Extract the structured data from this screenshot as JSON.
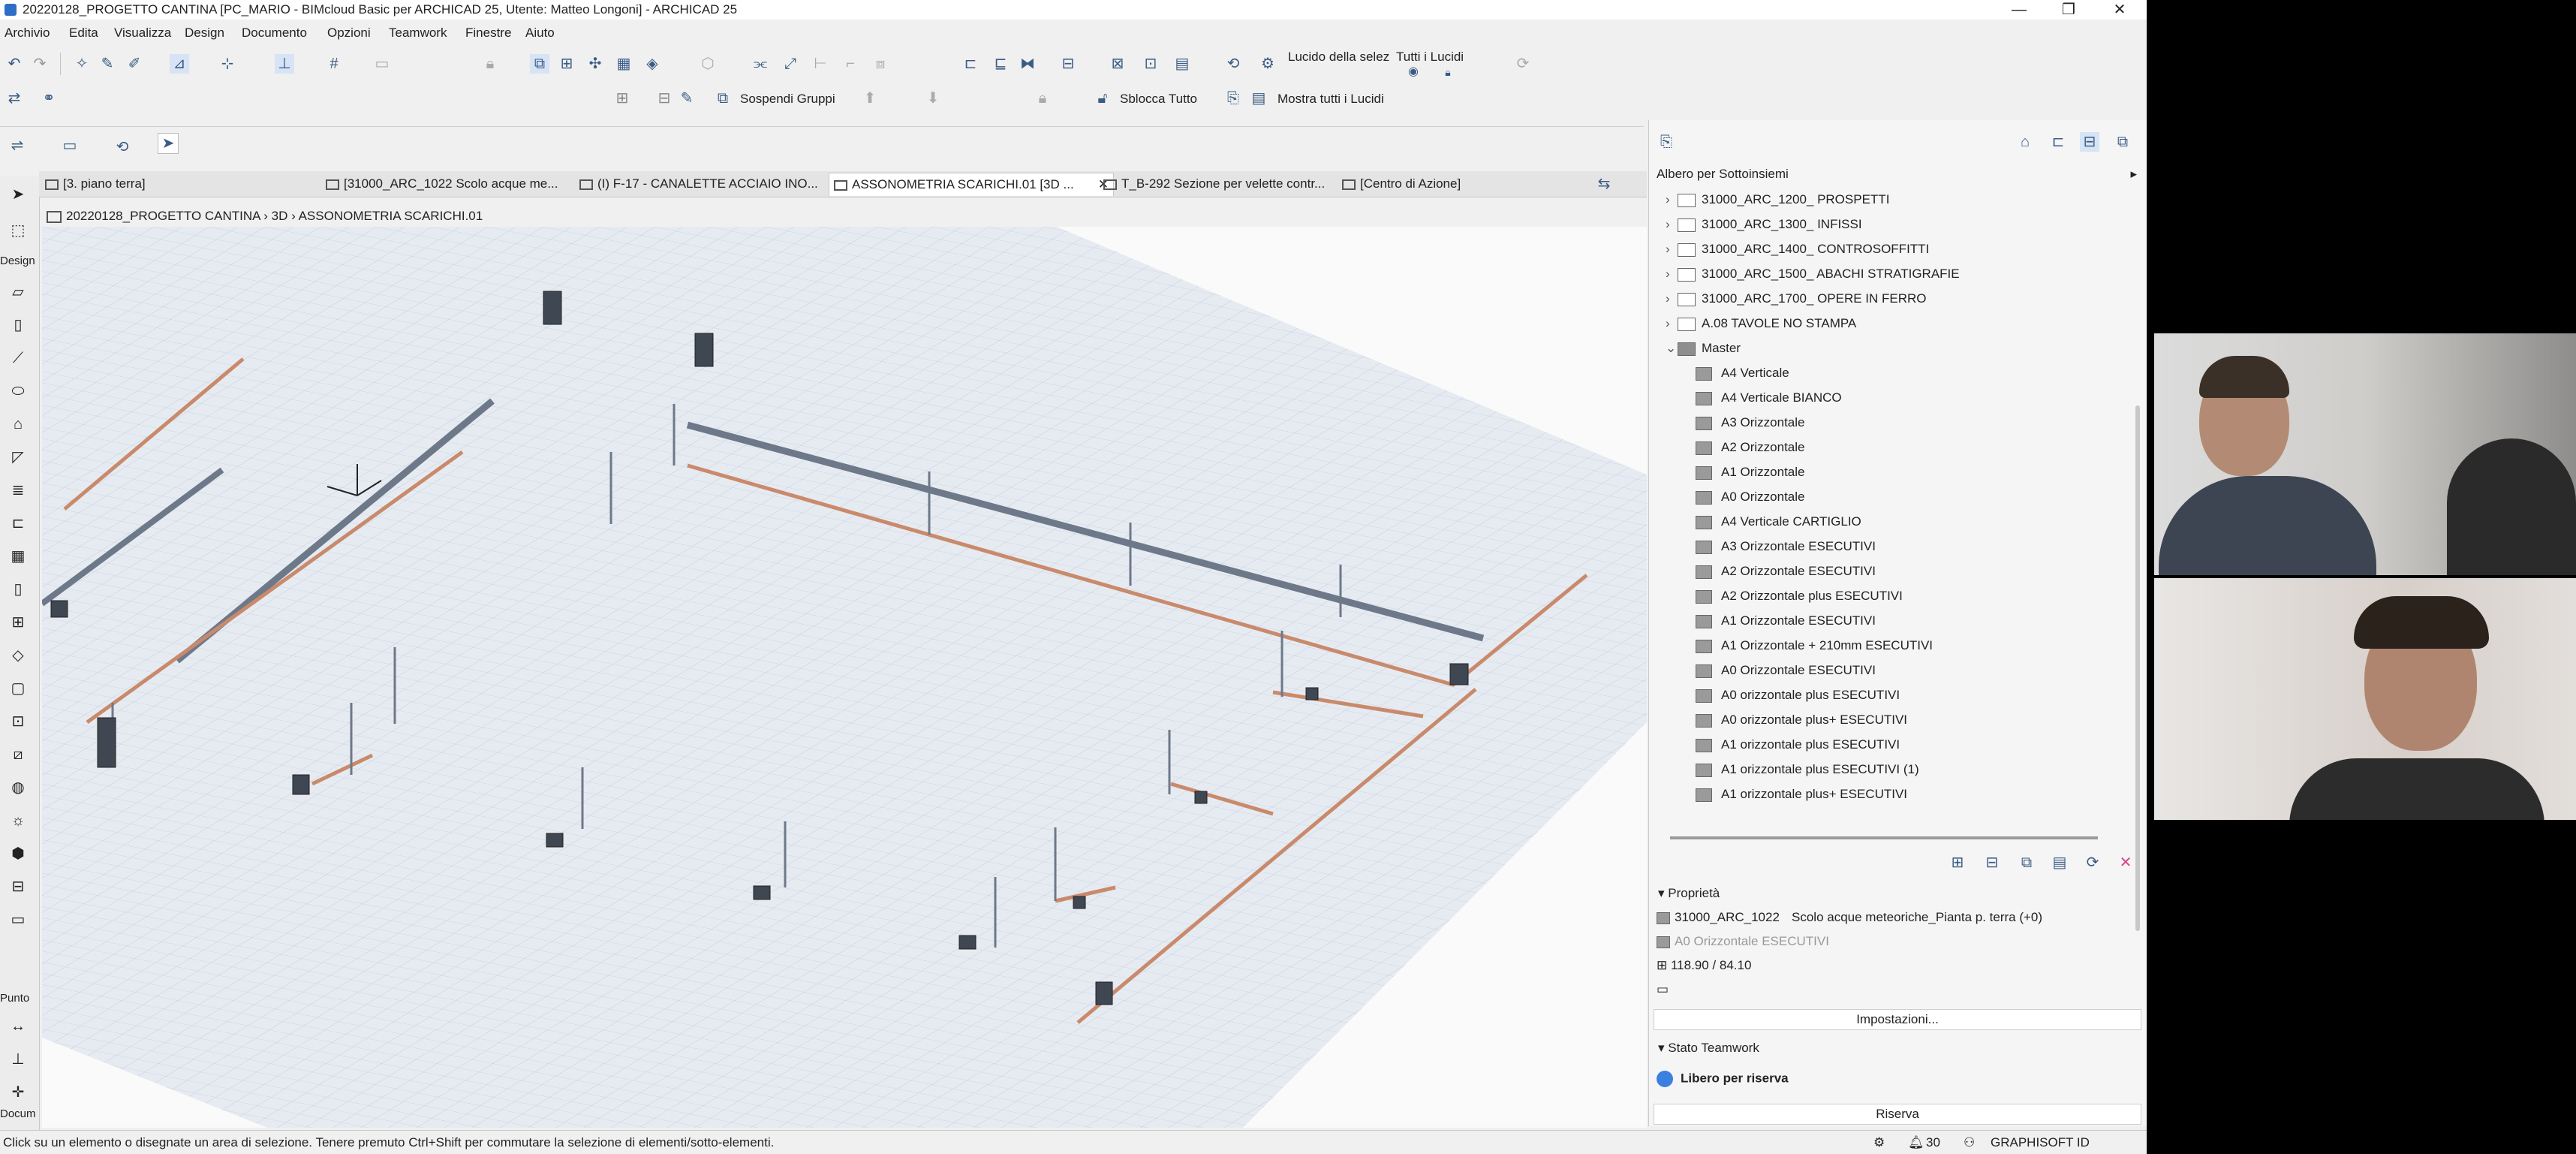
{
  "window": {
    "title": "20220128_PROGETTO CANTINA [PC_MARIO - BIMcloud Basic per ARCHICAD 25, Utente: Matteo Longoni] - ARCHICAD 25",
    "controls": [
      "—",
      "❐",
      "✕"
    ]
  },
  "menu": [
    "Archivio",
    "Edita",
    "Visualizza",
    "Design",
    "Documento",
    "Opzioni",
    "Teamwork",
    "Finestre",
    "Aiuto"
  ],
  "toolbar": {
    "lucido_selez": "Lucido della selez",
    "tutti_lucidi": "Tutti i Lucidi",
    "sospendi_gruppi": "Sospendi Gruppi",
    "sblocca_tutto": "Sblocca Tutto",
    "mostra_tutti_lucidi": "Mostra tutti i Lucidi"
  },
  "toolbox": {
    "design_label": "Design",
    "punto_label": "Punto",
    "docum_label": "Docum"
  },
  "tabs": [
    {
      "label": "[3. piano terra]",
      "active": false
    },
    {
      "label": "[31000_ARC_1022 Scolo acque me...",
      "active": false
    },
    {
      "label": "(I) F-17 - CANALETTE ACCIAIO INO...",
      "active": false
    },
    {
      "label": "ASSONOMETRIA SCARICHI.01 [3D ...",
      "active": true
    },
    {
      "label": "T_B-292 Sezione per velette contr...",
      "active": false
    },
    {
      "label": "[Centro di Azione]",
      "active": false
    }
  ],
  "breadcrumb": "20220128_PROGETTO CANTINA › 3D › ASSONOMETRIA SCARICHI.01",
  "navigator": {
    "header": "Albero per Sottoinsiemi",
    "folders": [
      "31000_ARC_1200_ PROSPETTI",
      "31000_ARC_1300_ INFISSI",
      "31000_ARC_1400_ CONTROSOFFITTI",
      "31000_ARC_1500_ ABACHI STRATIGRAFIE",
      "31000_ARC_1700_ OPERE IN FERRO",
      "A.08 TAVOLE NO STAMPA"
    ],
    "master_label": "Master",
    "masters": [
      "A4 Verticale",
      "A4 Verticale BIANCO",
      "A3 Orizzontale",
      "A2 Orizzontale",
      "A1 Orizzontale",
      "A0 Orizzontale",
      "A4 Verticale CARTIGLIO",
      "A3 Orizzontale ESECUTIVI",
      "A2 Orizzontale ESECUTIVI",
      "A2 Orizzontale plus ESECUTIVI",
      "A1 Orizzontale ESECUTIVI",
      "A1 Orizzontale + 210mm  ESECUTIVI",
      "A0 Orizzontale ESECUTIVI",
      "A0 orizzontale plus ESECUTIVI",
      "A0 orizzontale plus+ ESECUTIVI",
      "A1 orizzontale plus ESECUTIVI",
      "A1 orizzontale plus ESECUTIVI  (1)",
      "A1 orizzontale plus+ ESECUTIVI"
    ]
  },
  "properties": {
    "section": "Proprietà",
    "id": "31000_ARC_1022",
    "name": "Scolo acque meteoriche_Pianta p. terra (+0)",
    "master": "A0 Orizzontale ESECUTIVI",
    "size": "118.90 / 84.10",
    "settings_button": "Impostazioni..."
  },
  "teamwork": {
    "section": "Stato Teamwork",
    "status": "Libero per riserva",
    "status_color": "#3b7fe0",
    "reserve_button": "Riserva"
  },
  "status": {
    "message": "Click su un elemento o disegnate un area di selezione. Tenere premuto Ctrl+Shift per commutare la selezione di elementi/sotto-elementi.",
    "count": "30",
    "brand": "GRAPHISOFT ID"
  }
}
